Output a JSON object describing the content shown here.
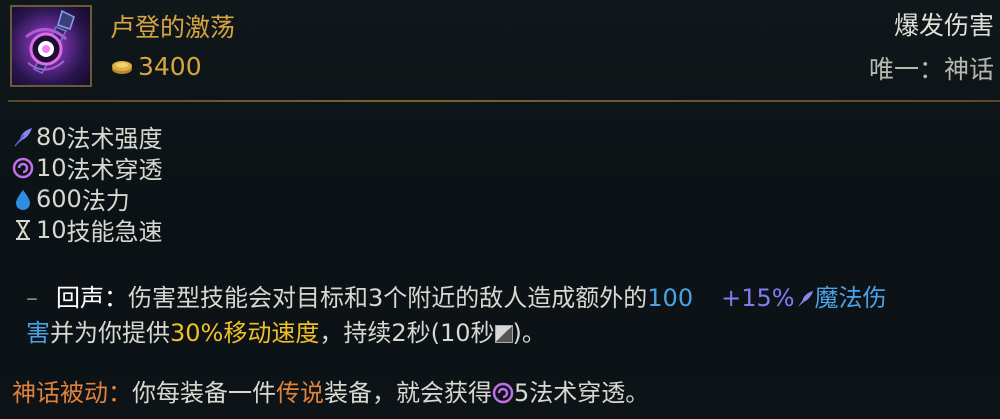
{
  "item": {
    "name": "卢登的激荡",
    "cost": "3400",
    "category": "爆发伤害",
    "unique": "唯一：神话"
  },
  "icons": {
    "item": "luden-echo-staff-icon",
    "gold": "gold-coin-icon",
    "ability_power": "quill-icon",
    "magic_penetration": "spiral-icon",
    "mana": "water-drop-icon",
    "ability_haste": "hourglass-icon",
    "cooldown": "cooldown-box-icon"
  },
  "stats": [
    {
      "value": "80",
      "label": "法术强度"
    },
    {
      "value": "10",
      "label": "法术穿透"
    },
    {
      "value": "600",
      "label": "法力"
    },
    {
      "value": "10",
      "label": "技能急速"
    }
  ],
  "passive": {
    "dash": "–",
    "name": "回声：",
    "text1": "伤害型技能会对目标和3个附近的敌人造成额外的",
    "damage": "100",
    "ratio": "+15%",
    "dmg_type_a": "魔法伤",
    "dmg_type_b": "害",
    "text2": "并为你提供",
    "ms": "30%移动速度",
    "text3": "，持续2秒(10秒",
    "text4": ")。"
  },
  "mythic": {
    "name": "神话被动：",
    "text1": "你每装备一件",
    "legendary": "传说",
    "text2": "装备，就会获得",
    "value": "5",
    "stat": "法术穿透。"
  },
  "colors": {
    "gold": "#d6a542",
    "magic_blue": "#4aa2e6",
    "ap_violet": "#7e7ef0",
    "ms_yellow": "#f0c028",
    "mythic_orange": "#e0823a"
  }
}
